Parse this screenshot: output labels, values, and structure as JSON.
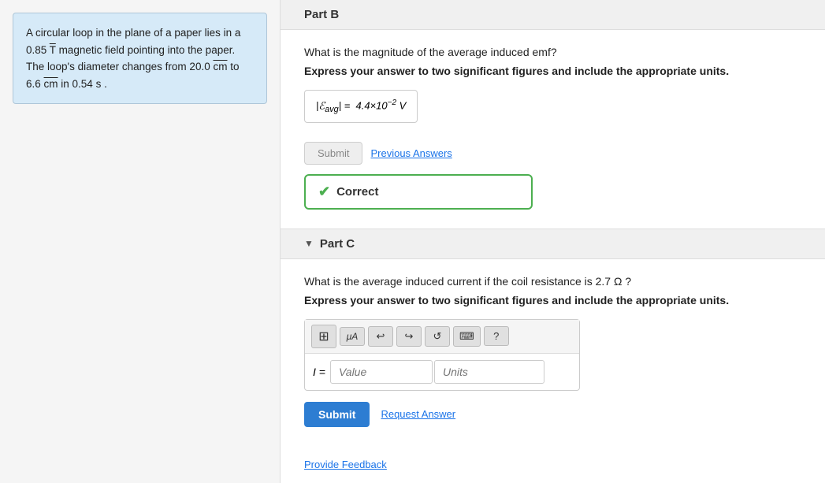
{
  "sidebar": {
    "problem": {
      "text_parts": [
        "A circular loop in the plane of a paper lies in a 0.85 T magnetic field pointing into the paper. The loop's diameter changes from 20.0 cm to 6.6 cm in 0.54 s ."
      ],
      "b_value": "0.85",
      "b_unit": "T",
      "d1": "20.0",
      "d1_unit": "cm",
      "d2": "6.6",
      "d2_unit": "cm",
      "time": "0.54",
      "time_unit": "s"
    }
  },
  "partB": {
    "label": "Part B",
    "question": "What is the magnitude of the average induced emf?",
    "instruction": "Express your answer to two significant figures and include the appropriate units.",
    "answer_display": "|ℰavg| = 4.4×10⁻² V",
    "submit_label": "Submit",
    "prev_answers_label": "Previous Answers",
    "correct_label": "Correct"
  },
  "partC": {
    "label": "Part C",
    "question": "What is the average induced current if the coil resistance is 2.7 Ω ?",
    "instruction": "Express your answer to two significant figures and include the appropriate units.",
    "input_label": "I =",
    "value_placeholder": "Value",
    "units_placeholder": "Units",
    "submit_label": "Submit",
    "request_answer_label": "Request Answer",
    "toolbar": {
      "grid_icon": "⊞",
      "units_icon": "μA",
      "undo_icon": "↩",
      "redo_icon": "↪",
      "refresh_icon": "↺",
      "keyboard_icon": "⌨",
      "help_icon": "?"
    }
  },
  "footer": {
    "provide_feedback": "Provide Feedback"
  }
}
